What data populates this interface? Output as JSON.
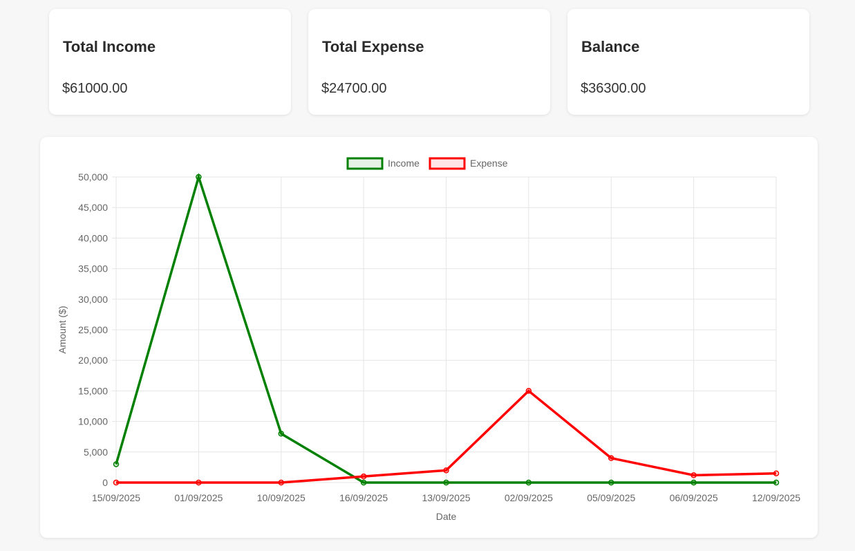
{
  "summary": {
    "income": {
      "title": "Total Income",
      "value": "$61000.00"
    },
    "expense": {
      "title": "Total Expense",
      "value": "$24700.00"
    },
    "balance": {
      "title": "Balance",
      "value": "$36300.00"
    }
  },
  "chart_data": {
    "type": "line",
    "xlabel": "Date",
    "ylabel": "Amount ($)",
    "ylim": [
      0,
      50000
    ],
    "ytick_step": 5000,
    "grid": true,
    "legend_position": "top-center",
    "categories": [
      "15/09/2025",
      "01/09/2025",
      "10/09/2025",
      "16/09/2025",
      "13/09/2025",
      "02/09/2025",
      "05/09/2025",
      "06/09/2025",
      "12/09/2025"
    ],
    "series": [
      {
        "name": "Income",
        "color": "#008000",
        "values": [
          3000,
          50000,
          8000,
          0,
          0,
          0,
          0,
          0,
          0
        ]
      },
      {
        "name": "Expense",
        "color": "#ff0000",
        "values": [
          0,
          0,
          0,
          1000,
          2000,
          15000,
          4000,
          1200,
          1500
        ]
      }
    ]
  }
}
